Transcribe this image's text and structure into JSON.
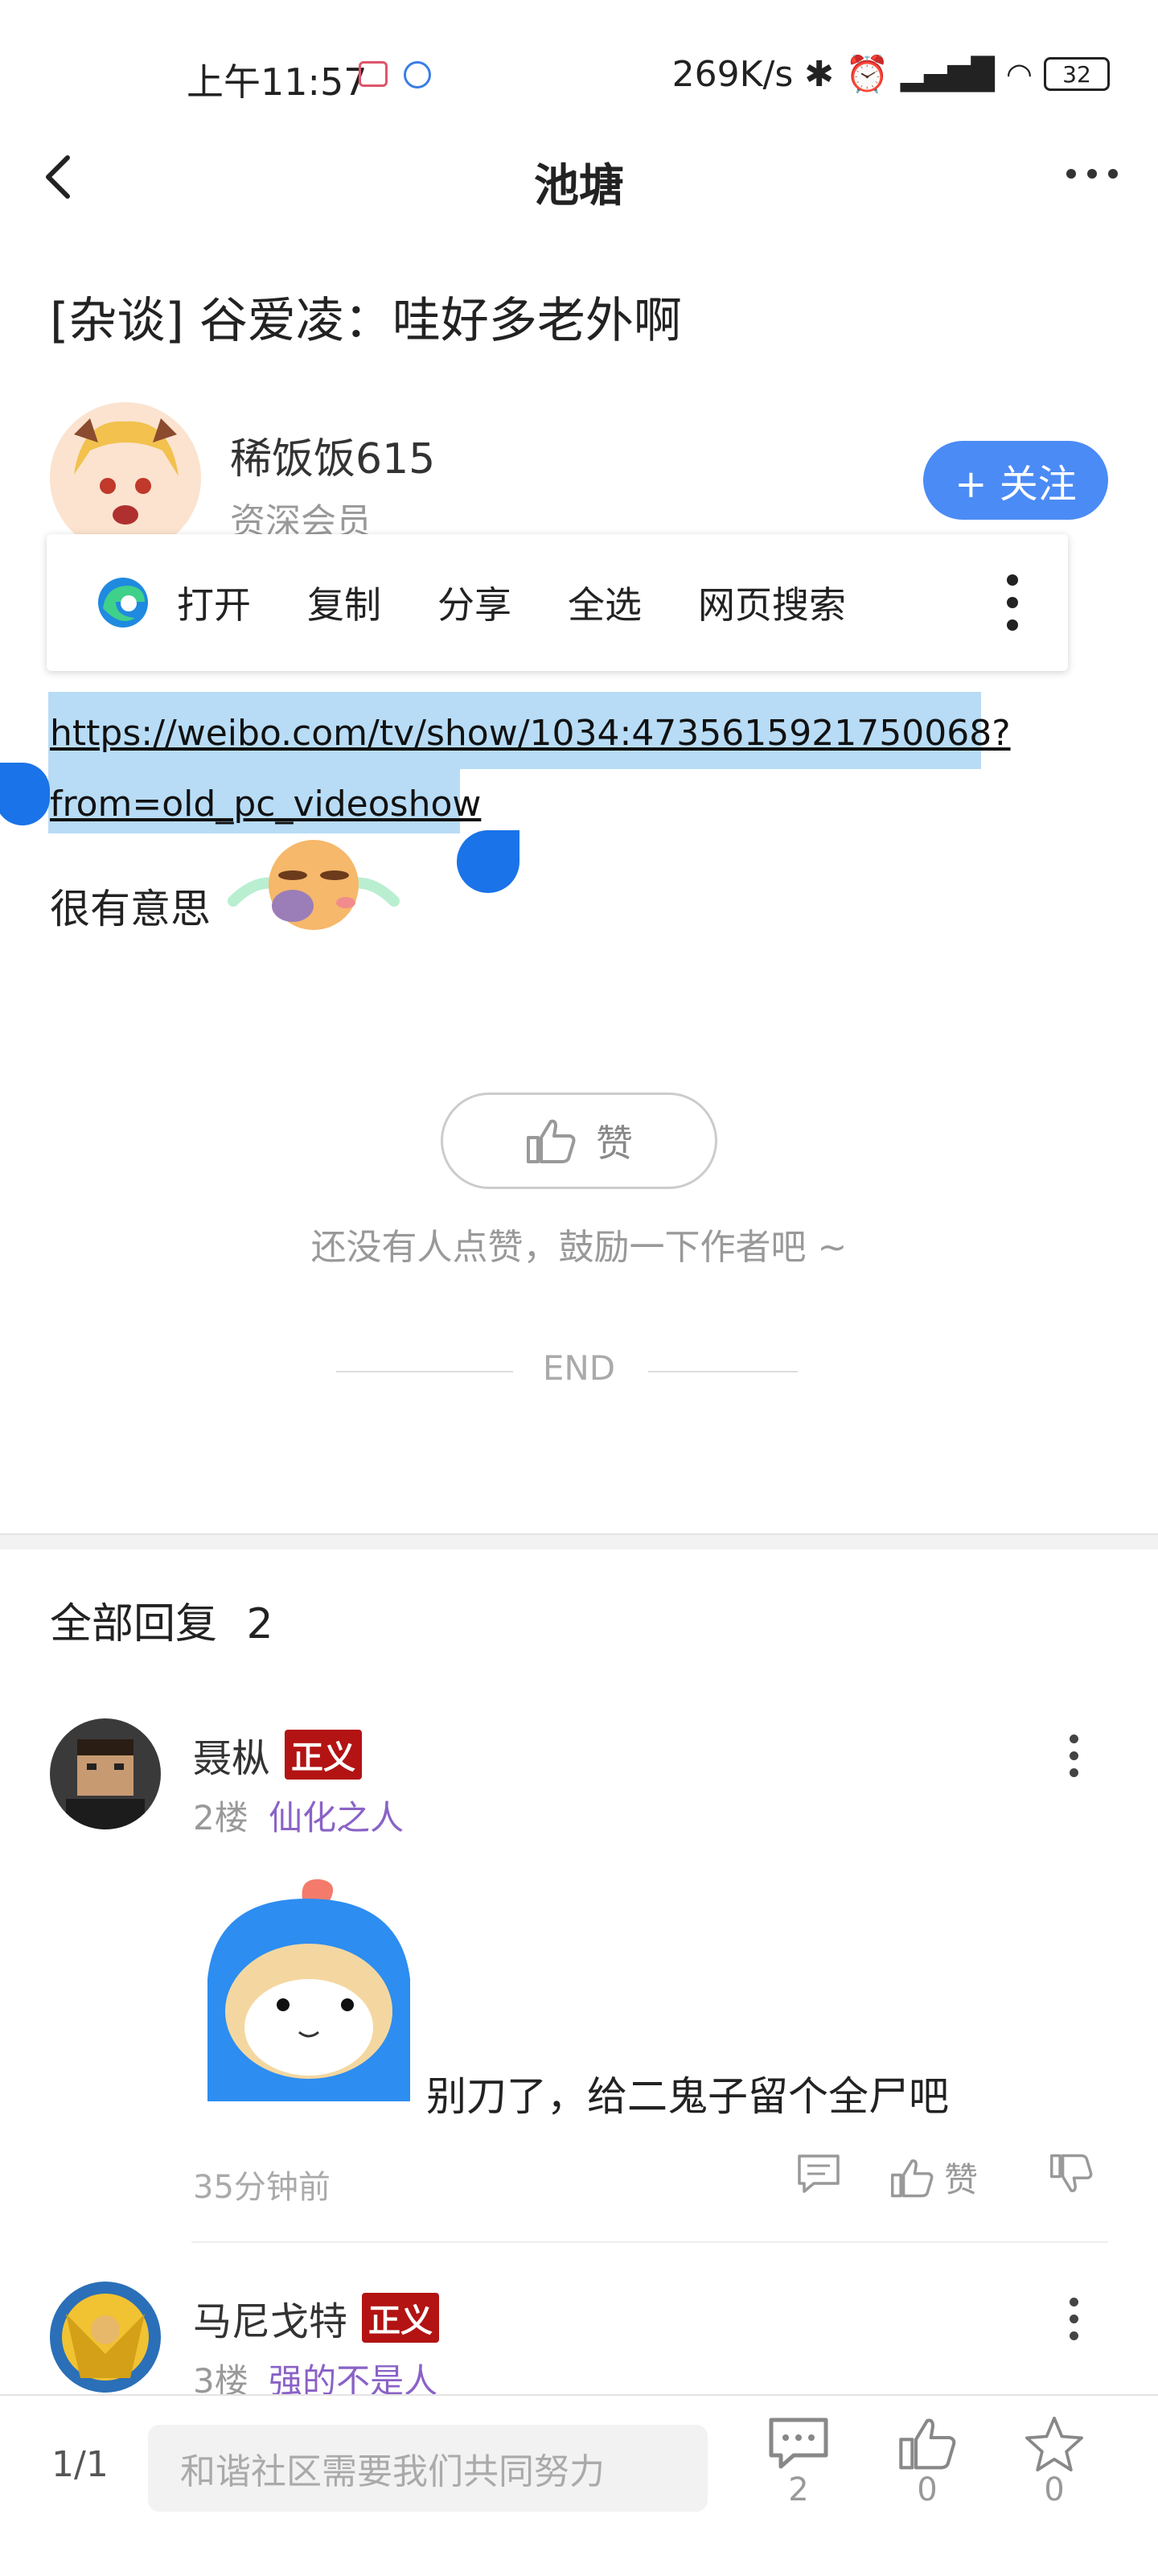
{
  "status_bar": {
    "time": "上午11:57",
    "net_speed": "269K/s",
    "battery": "32"
  },
  "nav": {
    "title": "池塘"
  },
  "post": {
    "title": "[杂谈] 谷爱凌：哇好多老外啊",
    "author": {
      "name": "稀饭饭615",
      "level": "资深会员"
    },
    "follow_label": "+ 关注",
    "link_line1": "https://weibo.com/tv/show/1034:4735615921750068?",
    "link_line2": "from=old_pc_videoshow",
    "text": "很有意思",
    "like_label": "赞",
    "like_hint": "还没有人点赞，鼓励一下作者吧 ~",
    "end_label": "END"
  },
  "context_menu": {
    "items": [
      "打开",
      "复制",
      "分享",
      "全选",
      "网页搜索"
    ]
  },
  "replies": {
    "header": "全部回复",
    "count": "2",
    "items": [
      {
        "name": "聂枞",
        "badge": "正义",
        "floor": "2楼",
        "title": "仙化之人",
        "text": "别刀了，给二鬼子留个全尸吧",
        "time": "35分钟前",
        "like_label": "赞"
      },
      {
        "name": "马尼戈特",
        "badge": "正义",
        "floor": "3楼",
        "title": "强的不是人"
      }
    ]
  },
  "bottom_bar": {
    "page": "1/1",
    "input_placeholder": "和谐社区需要我们共同努力",
    "comments": "2",
    "likes": "0",
    "favorites": "0"
  },
  "colors": {
    "accent": "#4b8bf5",
    "selection": "#b8dcf6",
    "handle": "#1a73e8",
    "badge": "#b31313",
    "title_purple": "#8a62c7"
  }
}
